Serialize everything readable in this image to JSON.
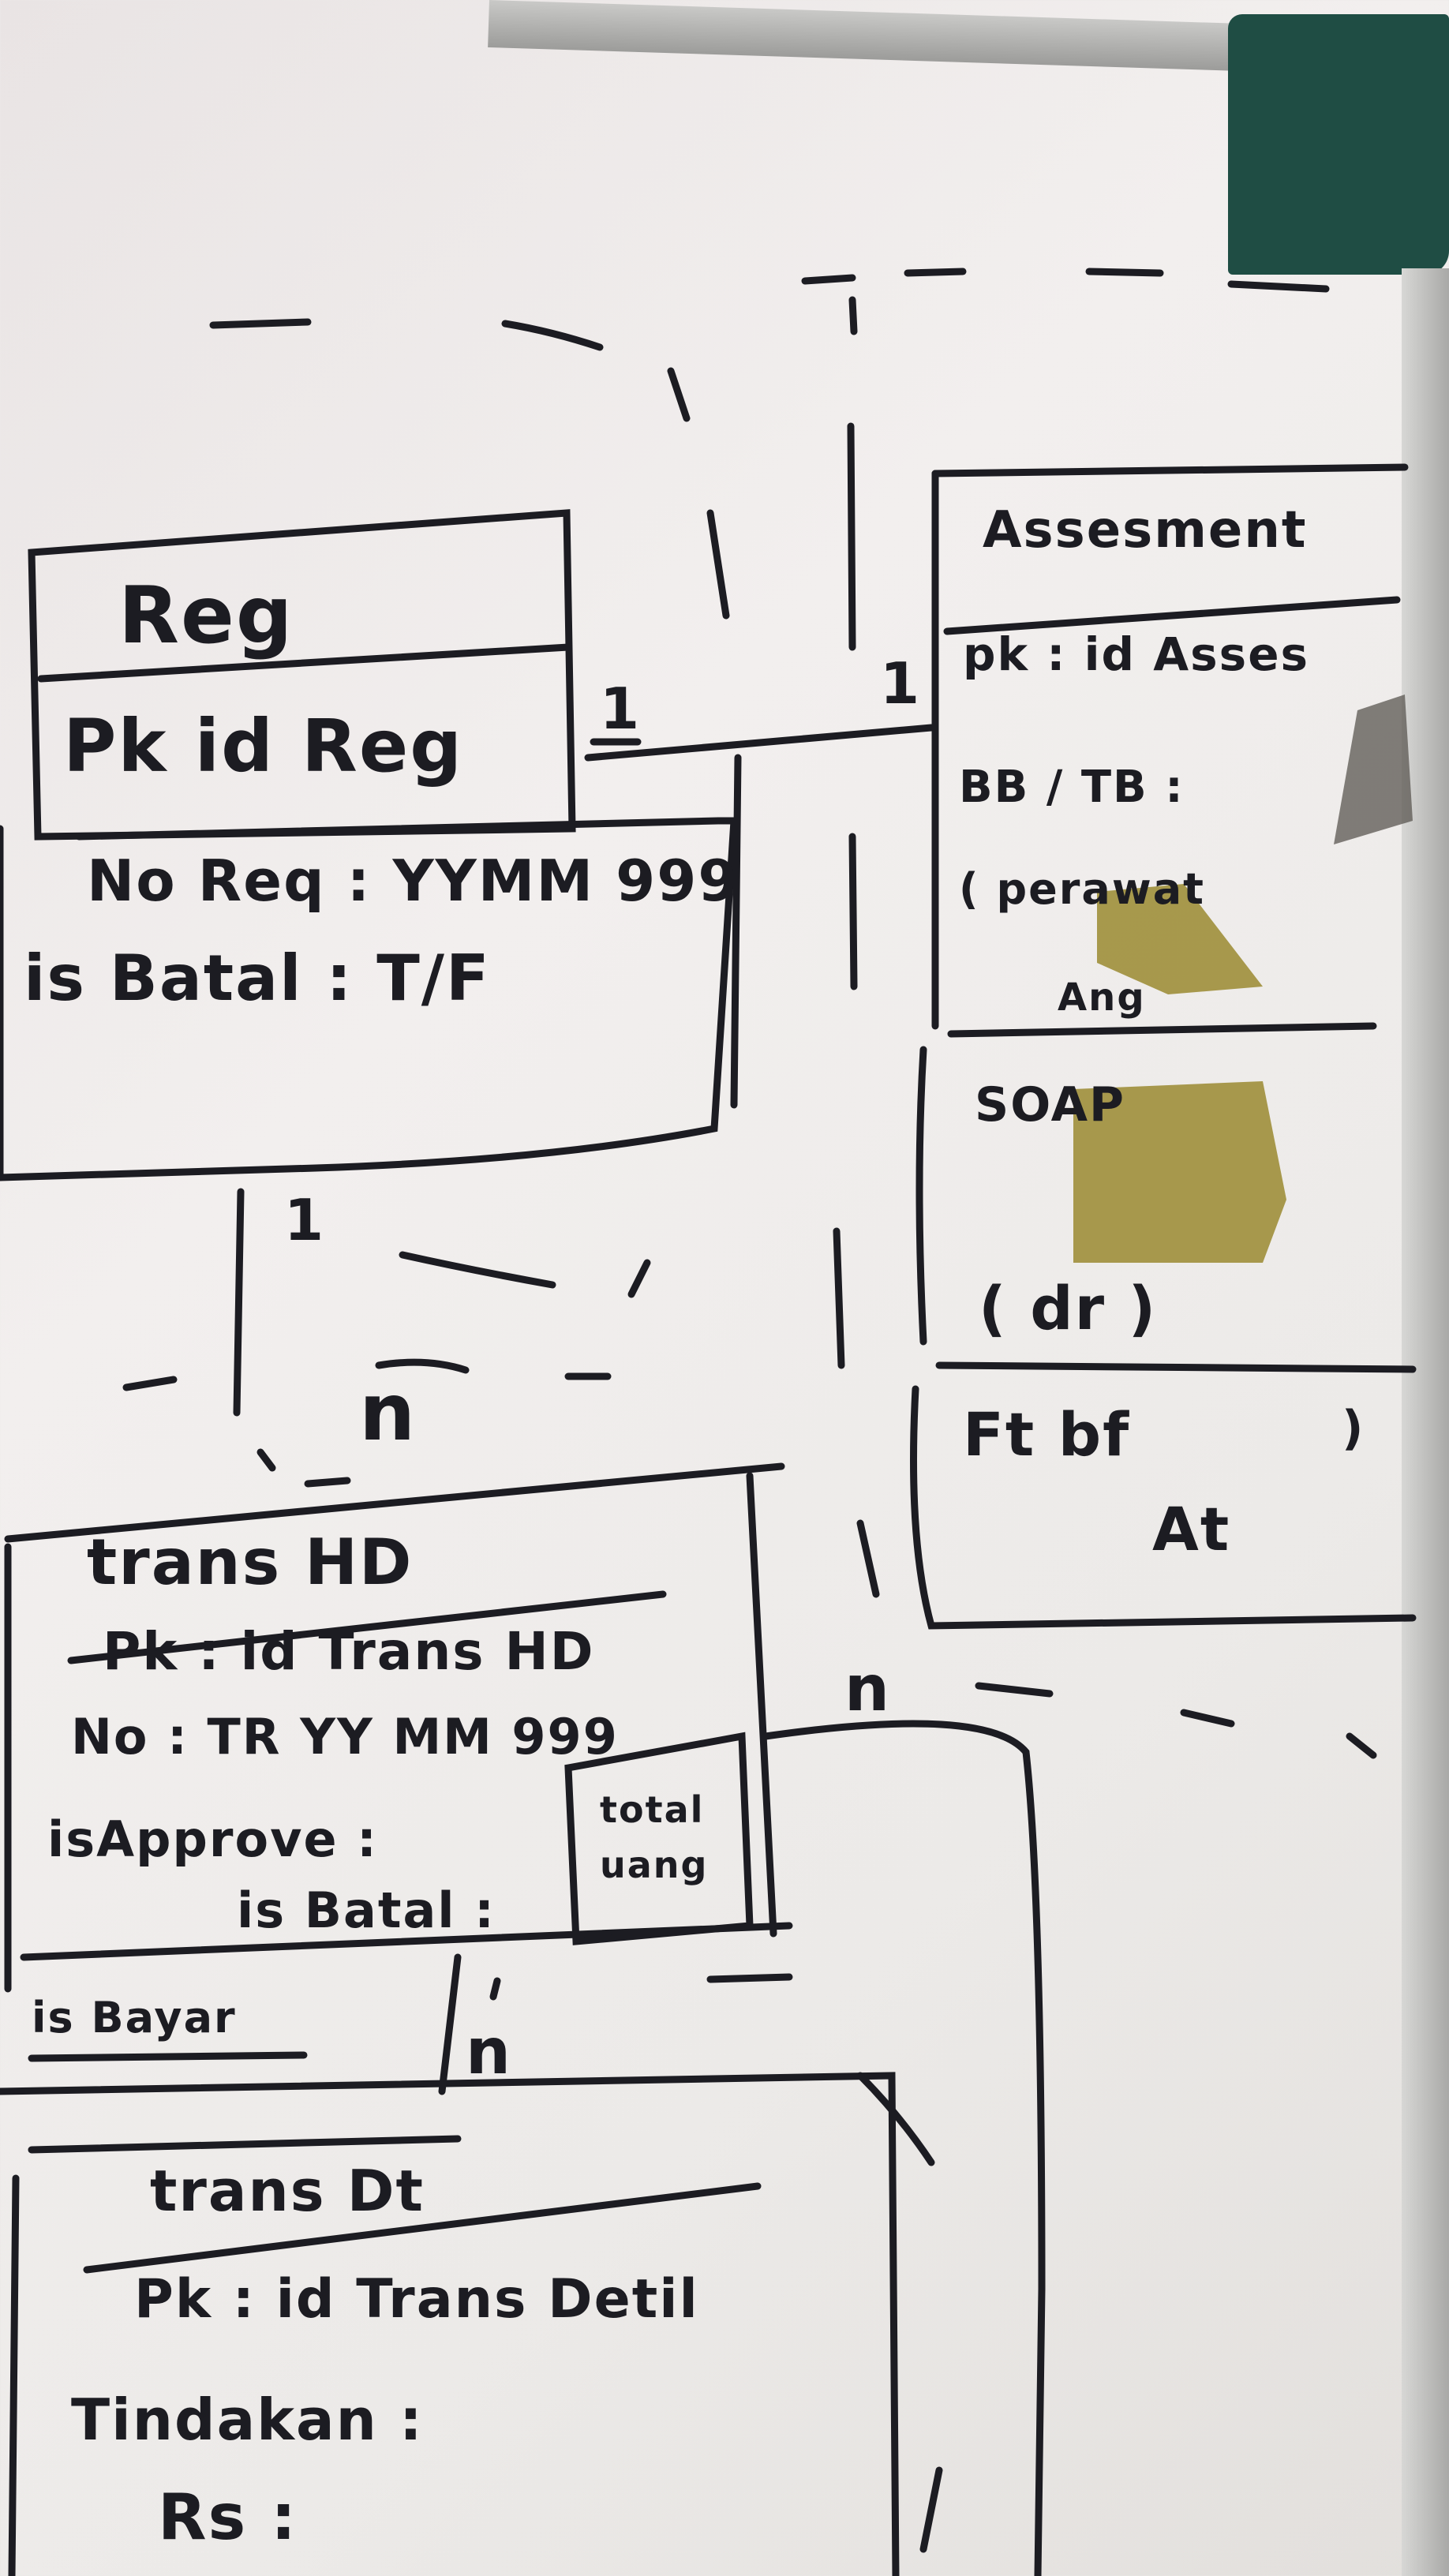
{
  "diagram": {
    "entities": {
      "reg": {
        "title": "Reg",
        "pk": "Pk   id Reg",
        "fields": [
          "No Req : YYMM 999",
          "is Batal   : T/F"
        ]
      },
      "assesment": {
        "title": "Assesment",
        "fields": [
          "pk  : id Asses",
          "BB / TB  :",
          "( perawat",
          "Ang"
        ],
        "section2": [
          "SOAP",
          "( dr )"
        ],
        "section3": [
          "Ft  bf",
          "At"
        ]
      },
      "trans_hd": {
        "title": "trans HD",
        "fields": [
          "Pk  : id Trans HD",
          "No  : TR YY MM 999",
          "isApprove :",
          "is Batal :"
        ],
        "side_note": [
          "total",
          "uang"
        ],
        "below": "is Bayar"
      },
      "trans_dt": {
        "title": "trans Dt",
        "fields": [
          "Pk : id Trans Detil",
          "Tindakan :",
          "Rs          :"
        ]
      }
    },
    "cardinalities": {
      "reg_assesment_left": "1",
      "reg_assesment_right": "1",
      "reg_trans_top": "1",
      "reg_trans_bottom": "n",
      "trans_hd_dt": "n",
      "trans_hd_right": "n"
    },
    "colors": {
      "ink": "#1c1c22",
      "board": "#eceae8",
      "frame": "#b4b4b2",
      "frame_corner": "#1f4d44",
      "sticker": "#9a8a30"
    }
  }
}
